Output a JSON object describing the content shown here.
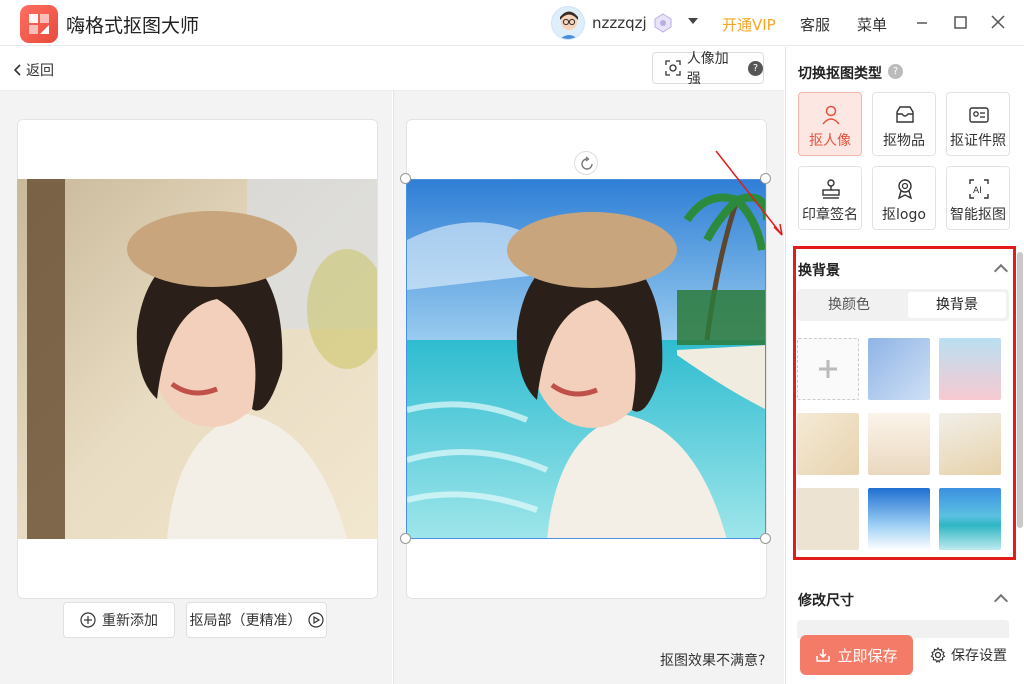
{
  "app": {
    "name": "嗨格式抠图大师"
  },
  "header": {
    "username": "nzzzqzj",
    "vip_label": "开通VIP",
    "service_label": "客服",
    "menu_label": "菜单",
    "accent_vip": "#f5a623"
  },
  "toolbar": {
    "back_label": "返回",
    "enhance_label": "人像加强"
  },
  "left_pane": {
    "readd_label": "重新添加",
    "local_label": "抠局部（更精准）"
  },
  "mid_pane": {
    "unsatisfied_label": "抠图效果不满意?"
  },
  "sidebar": {
    "type_title": "切换抠图类型",
    "types": [
      {
        "label": "抠人像",
        "icon": "person-icon",
        "active": true
      },
      {
        "label": "抠物品",
        "icon": "box-icon",
        "active": false
      },
      {
        "label": "抠证件照",
        "icon": "id-card-icon",
        "active": false
      },
      {
        "label": "印章签名",
        "icon": "stamp-icon",
        "active": false
      },
      {
        "label": "抠logo",
        "icon": "badge-icon",
        "active": false
      },
      {
        "label": "智能抠图",
        "icon": "ai-icon",
        "active": false
      }
    ],
    "bg_title": "换背景",
    "tabs": [
      {
        "label": "换颜色",
        "selected": false
      },
      {
        "label": "换背景",
        "selected": true
      }
    ],
    "resize_title": "修改尺寸",
    "save_label": "立即保存",
    "save_settings_label": "保存设置",
    "accent_color": "#e8523f"
  }
}
